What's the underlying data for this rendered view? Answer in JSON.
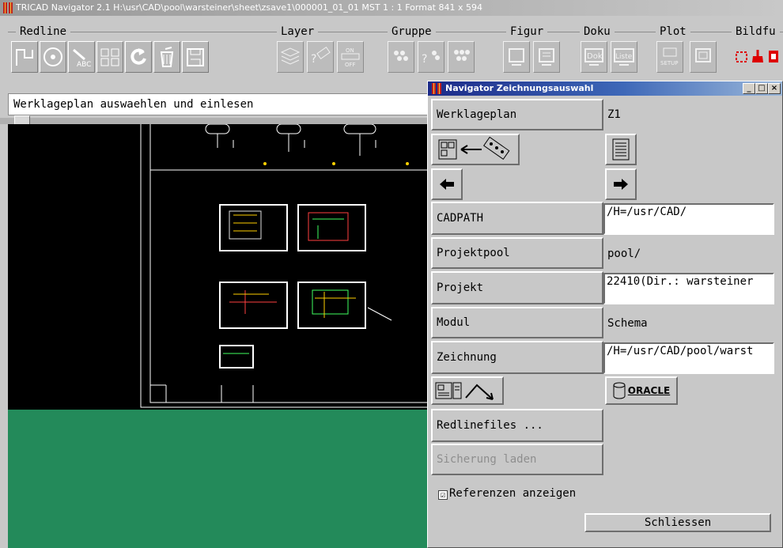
{
  "window": {
    "title": "TRICAD Navigator 2.1 H:\\usr\\CAD\\pool\\warsteiner\\sheet\\zsave1\\000001_01_01 MST 1 : 1 Format 841 x 594"
  },
  "toolbar": {
    "groups": [
      "Redline",
      "Layer",
      "Gruppe",
      "Figur",
      "Doku",
      "Plot",
      "Bildfu"
    ],
    "buttons": {
      "redline": [
        "polyline-icon",
        "circle-icon",
        "text-abc-icon",
        "mirror-icon",
        "undo-icon",
        "trash-icon",
        "save-icon"
      ],
      "layer": [
        "layers-icon",
        "layer-query-icon",
        "on-off-icon"
      ],
      "gruppe": [
        "group-icon",
        "group-query-icon",
        "group-select-icon"
      ],
      "figur": [
        "figure-monitor-icon",
        "figure-list-icon"
      ],
      "doku": [
        "doku-icon",
        "liste-icon"
      ],
      "plot": [
        "plot-setup-icon",
        "plot-preview-icon"
      ],
      "bildfu": [
        "zoom-window-icon",
        "brush-icon",
        "red-tool-icon"
      ]
    },
    "labels": {
      "dok": "Dok",
      "liste": "Liste",
      "on": "ON",
      "off": "OFF",
      "setup": "SETUP"
    }
  },
  "command_line": {
    "text": "Werklageplan auswaehlen und einlesen"
  },
  "dialog": {
    "title": "Navigator Zeichnungsauswahl",
    "window_buttons": [
      "_",
      "□",
      "×"
    ],
    "werklageplan_button": "Werklageplan",
    "werklageplan_value": "Z1",
    "cadpath_button": "CADPATH",
    "cadpath_value": "/H=/usr/CAD/",
    "projektpool_button": "Projektpool",
    "projektpool_value": "pool/",
    "projekt_button": "Projekt",
    "projekt_value": "22410(Dir.: warsteiner",
    "modul_button": "Modul",
    "modul_value": "Schema",
    "zeichnung_button": "Zeichnung",
    "zeichnung_value": "/H=/usr/CAD/pool/warst",
    "oracle_label": "ORACLE",
    "redlinefiles_button": "Redlinefiles ...",
    "sicherung_button": "Sicherung laden",
    "referenzen_label": "Referenzen anzeigen",
    "referenzen_checked": "☑",
    "schliessen_button": "Schliessen"
  },
  "colors": {
    "canvas_bg": "#000000",
    "lower_area": "#238a5a",
    "title_gradient_start": "#1b2a88",
    "accent_red": "#c2231a"
  }
}
